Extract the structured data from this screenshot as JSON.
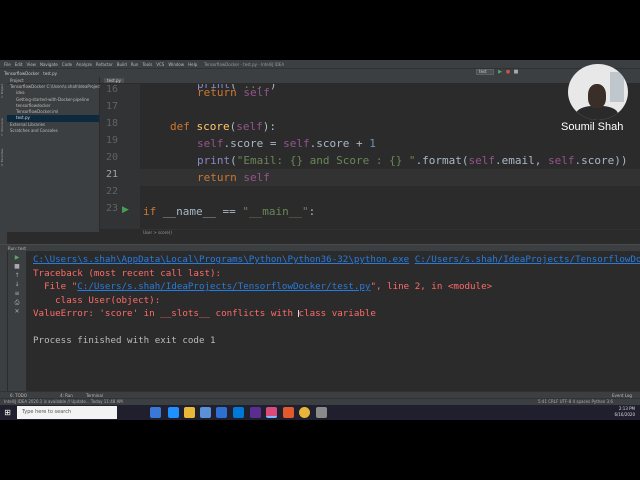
{
  "window": {
    "menu": [
      "File",
      "Edit",
      "View",
      "Navigate",
      "Code",
      "Analyze",
      "Refactor",
      "Build",
      "Run",
      "Tools",
      "VCS",
      "Window",
      "Help"
    ],
    "title": "TensorflowDocker - test.py - IntelliJ IDEA",
    "breadcrumb": [
      "TensorflowDocker",
      "test.py"
    ],
    "run_config": "test"
  },
  "project": {
    "header": "Project",
    "items": [
      {
        "label": "TensorflowDocker  C:\\Users\\s.shah\\IdeaProjects",
        "indent": 0,
        "selected": false
      },
      {
        "label": "idea",
        "indent": 1,
        "selected": false
      },
      {
        "label": "Getting-started-with-Docker-pipeline",
        "indent": 1,
        "selected": false
      },
      {
        "label": "tensorflowdocker",
        "indent": 1,
        "selected": false
      },
      {
        "label": "TensorflowDocker.iml",
        "indent": 1,
        "selected": false
      },
      {
        "label": "test.py",
        "indent": 1,
        "selected": true
      },
      {
        "label": "External Libraries",
        "indent": 0,
        "selected": false
      },
      {
        "label": "Scratches and Consoles",
        "indent": 0,
        "selected": false
      }
    ]
  },
  "editor": {
    "tab": "test.py",
    "line_numbers": [
      "16",
      "17",
      "18",
      "19",
      "20",
      "21",
      "22",
      "23"
    ],
    "current_line": "21",
    "breadcrumb": "User  >  score()"
  },
  "run": {
    "header": "Run:    test",
    "console": {
      "command_link": "C:\\Users\\s.shah\\AppData\\Local\\Programs\\Python\\Python36-32\\python.exe",
      "command_arg_link": "C:/Users/s.shah/IdeaProjects/TensorflowDocker",
      "traceback": "Traceback (most recent call last):",
      "file_prefix": "  File \"",
      "file_link": "C:/Users/s.shah/IdeaProjects/TensorflowDocker/test.py",
      "file_suffix": "\", line 2, in <module>",
      "class_line": "    class User(object):",
      "error": "ValueError: 'score' in __slots__ conflicts with class variable",
      "finished": "Process finished with exit code 1"
    }
  },
  "bottom_tabs": [
    "6: TODO",
    "4: Run",
    "Terminal"
  ],
  "bottom_right_tab": "Event Log",
  "status": {
    "left": "IntelliJ IDEA 2020.1 is available // Update... Today 11:48 AM",
    "right": "5:41  CRLF  UTF-8  4 spaces  Python 3.6"
  },
  "taskbar": {
    "search_placeholder": "Type here to search",
    "time": "2:13 PM",
    "date": "6/16/2020"
  },
  "overlay": {
    "presenter_name": "Soumil Shah"
  }
}
